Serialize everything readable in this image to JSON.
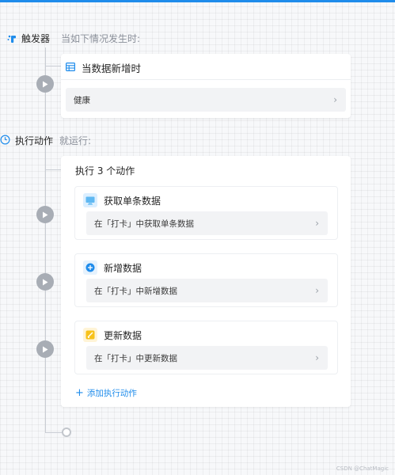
{
  "colors": {
    "accent": "#1f8ceb",
    "line": "#c9cdd4",
    "node": "#a8adb5",
    "add": "#1f8ceb",
    "update_badge": "#f7c21b"
  },
  "trigger": {
    "label": "触发器",
    "description": "当如下情况发生时:",
    "icon": "trigger-icon",
    "card_title": "当数据新增时",
    "card_icon": "table-icon",
    "source_value": "健康"
  },
  "action": {
    "label": "执行动作",
    "description": "就运行:",
    "icon": "timer-icon",
    "card_title": "执行 3 个动作",
    "steps": [
      {
        "title": "获取单条数据",
        "icon": "monitor-icon",
        "detail": "在「打卡」中获取单条数据"
      },
      {
        "title": "新增数据",
        "icon": "plus-circle-icon",
        "detail": "在「打卡」中新增数据"
      },
      {
        "title": "更新数据",
        "icon": "edit-icon",
        "detail": "在「打卡」中更新数据"
      }
    ],
    "add_label": "添加执行动作"
  },
  "watermark": "CSDN @ChatMagic"
}
